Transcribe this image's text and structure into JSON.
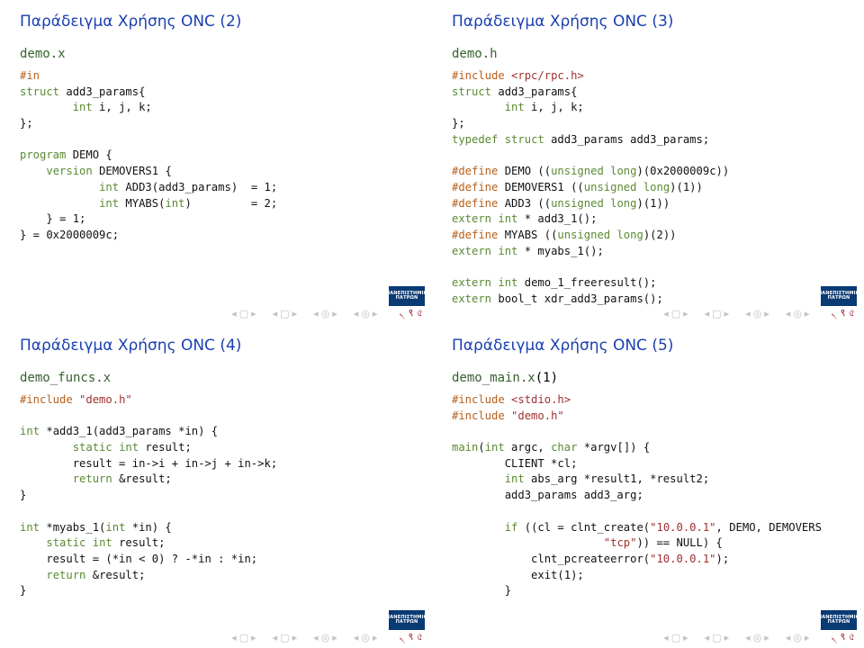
{
  "slides": [
    {
      "title": "Παράδειγμα Χρήσης ONC (2)",
      "file_label": "demo.x",
      "code_html": "<span class=\"pre\">#in</span>\n<span class=\"kw\">struct</span> add3_params{\n        <span class=\"kw\">int</span> i, j, k;\n};\n\n<span class=\"kw\">program</span> DEMO {\n    <span class=\"kw\">version</span> DEMOVERS1 {\n            <span class=\"kw\">int</span> ADD3(add3_params)  = 1;\n            <span class=\"kw\">int</span> MYABS(<span class=\"kw\">int</span>)         = 2;\n    } = 1;\n} = 0x2000009c;"
    },
    {
      "title": "Παράδειγμα Χρήσης ONC (3)",
      "file_label": "demo.h",
      "code_html": "<span class=\"pre\">#include</span> <span class=\"str\">&lt;rpc/rpc.h&gt;</span>\n<span class=\"kw\">struct</span> add3_params{\n        <span class=\"kw\">int</span> i, j, k;\n};\n<span class=\"kw\">typedef</span> <span class=\"kw\">struct</span> add3_params add3_params;\n\n<span class=\"pre\">#define</span> DEMO ((<span class=\"kw\">unsigned</span> <span class=\"kw\">long</span>)(0x2000009c))\n<span class=\"pre\">#define</span> DEMOVERS1 ((<span class=\"kw\">unsigned</span> <span class=\"kw\">long</span>)(1))\n<span class=\"pre\">#define</span> ADD3 ((<span class=\"kw\">unsigned</span> <span class=\"kw\">long</span>)(1))\n<span class=\"kw\">extern</span> <span class=\"kw\">int</span> * add3_1();\n<span class=\"pre\">#define</span> MYABS ((<span class=\"kw\">unsigned</span> <span class=\"kw\">long</span>)(2))\n<span class=\"kw\">extern</span> <span class=\"kw\">int</span> * myabs_1();\n\n<span class=\"kw\">extern</span> <span class=\"kw\">int</span> demo_1_freeresult();\n<span class=\"kw\">extern</span> bool_t xdr_add3_params();"
    },
    {
      "title": "Παράδειγμα Χρήσης ONC (4)",
      "file_label": "demo_funcs.x",
      "code_html": "<span class=\"pre\">#include</span> <span class=\"str\">\"demo.h\"</span>\n\n<span class=\"kw\">int</span> *add3_1(add3_params *in) {\n        <span class=\"kw\">static</span> <span class=\"kw\">int</span> result;\n        result = in-&gt;i + in-&gt;j + in-&gt;k;\n        <span class=\"kw\">return</span> &amp;result;\n}\n\n<span class=\"kw\">int</span> *myabs_1(<span class=\"kw\">int</span> *in) {\n    <span class=\"kw\">static</span> <span class=\"kw\">int</span> result;\n    result = (*in &lt; 0) ? -*in : *in;\n    <span class=\"kw\">return</span> &amp;result;\n}"
    },
    {
      "title": "Παράδειγμα Χρήσης ONC (5)",
      "file_label_html": "demo_main.x<span class=\"paren\">(1)</span>",
      "code_html": "<span class=\"pre\">#include</span> <span class=\"str\">&lt;stdio.h&gt;</span>\n<span class=\"pre\">#include</span> <span class=\"str\">\"demo.h\"</span>\n\n<span class=\"kw\">main</span>(<span class=\"kw\">int</span> argc, <span class=\"kw\">char</span> *argv[]) {\n        CLIENT *cl;\n        <span class=\"kw\">int</span> abs_arg *result1, *result2;\n        add3_params add3_arg;\n\n        <span class=\"kw\">if</span> ((cl = clnt_create(<span class=\"str\">\"10.0.0.1\"</span>, DEMO, DEMOVERS\n                       <span class=\"str\">\"tcp\"</span>)) == NULL) {\n            clnt_pcreateerror(<span class=\"str\">\"10.0.0.1\"</span>);\n            exit(1);\n        }"
    }
  ],
  "logo_text": "ΠΑΝΕΠΙΣΤΗΜΙΟ ΠΑΤΡΩΝ",
  "nav_symbols": {
    "left": "◂",
    "right": "▸",
    "doc": "▢",
    "target": "◎",
    "qed": "৲ ९ ৫"
  }
}
